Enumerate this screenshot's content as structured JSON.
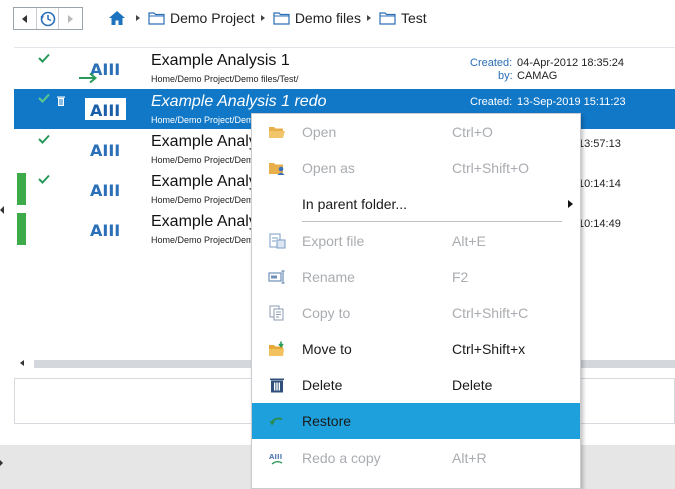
{
  "breadcrumb": {
    "items": [
      "Demo Project",
      "Demo files",
      "Test"
    ]
  },
  "rows": [
    {
      "title": "Example Analysis 1",
      "path": "Home/Demo Project/Demo files/Test/",
      "created_label": "Created:",
      "created_value": "04-Apr-2012 18:35:24",
      "by_label": "by:",
      "by_value": "CAMAG",
      "icon_text": "AIII"
    },
    {
      "title": "Example Analysis 1 redo",
      "path": "Home/Demo Project/Demo files/Test/",
      "created_label": "Created:",
      "created_value": "13-Sep-2019 15:11:23",
      "icon_text": "AIII"
    },
    {
      "title": "Example Analy",
      "path": "Home/Demo Project/Dem",
      "created_value": "13:57:13",
      "icon_text": "AIII"
    },
    {
      "title": "Example Analy",
      "path": "Home/Demo Project/Dem",
      "created_value": "10:14:14",
      "icon_text": "AIII"
    },
    {
      "title": "Example Analy",
      "path": "Home/Demo Project/Dem",
      "created_value": "10:14:49",
      "icon_text": "AIII"
    }
  ],
  "context_menu": {
    "items": [
      {
        "label": "Open",
        "shortcut": "Ctrl+O",
        "state": "disabled"
      },
      {
        "label": "Open as",
        "shortcut": "Ctrl+Shift+O",
        "state": "disabled"
      },
      {
        "label": "In parent folder...",
        "shortcut": "",
        "state": "enabled",
        "submenu": true
      },
      {
        "label": "Export file",
        "shortcut": "Alt+E",
        "state": "disabled"
      },
      {
        "label": "Rename",
        "shortcut": "F2",
        "state": "disabled"
      },
      {
        "label": "Copy to",
        "shortcut": "Ctrl+Shift+C",
        "state": "disabled"
      },
      {
        "label": "Move to",
        "shortcut": "Ctrl+Shift+x",
        "state": "enabled"
      },
      {
        "label": "Delete",
        "shortcut": "Delete",
        "state": "enabled"
      },
      {
        "label": "Restore",
        "shortcut": "",
        "state": "hover"
      },
      {
        "label": "Redo a copy",
        "shortcut": "Alt+R",
        "state": "disabled"
      }
    ]
  },
  "colors": {
    "selection": "#1178c8",
    "menu_hover": "#1ea0dc",
    "status_green": "#3eab4a",
    "accent_blue": "#2b6fb6"
  }
}
